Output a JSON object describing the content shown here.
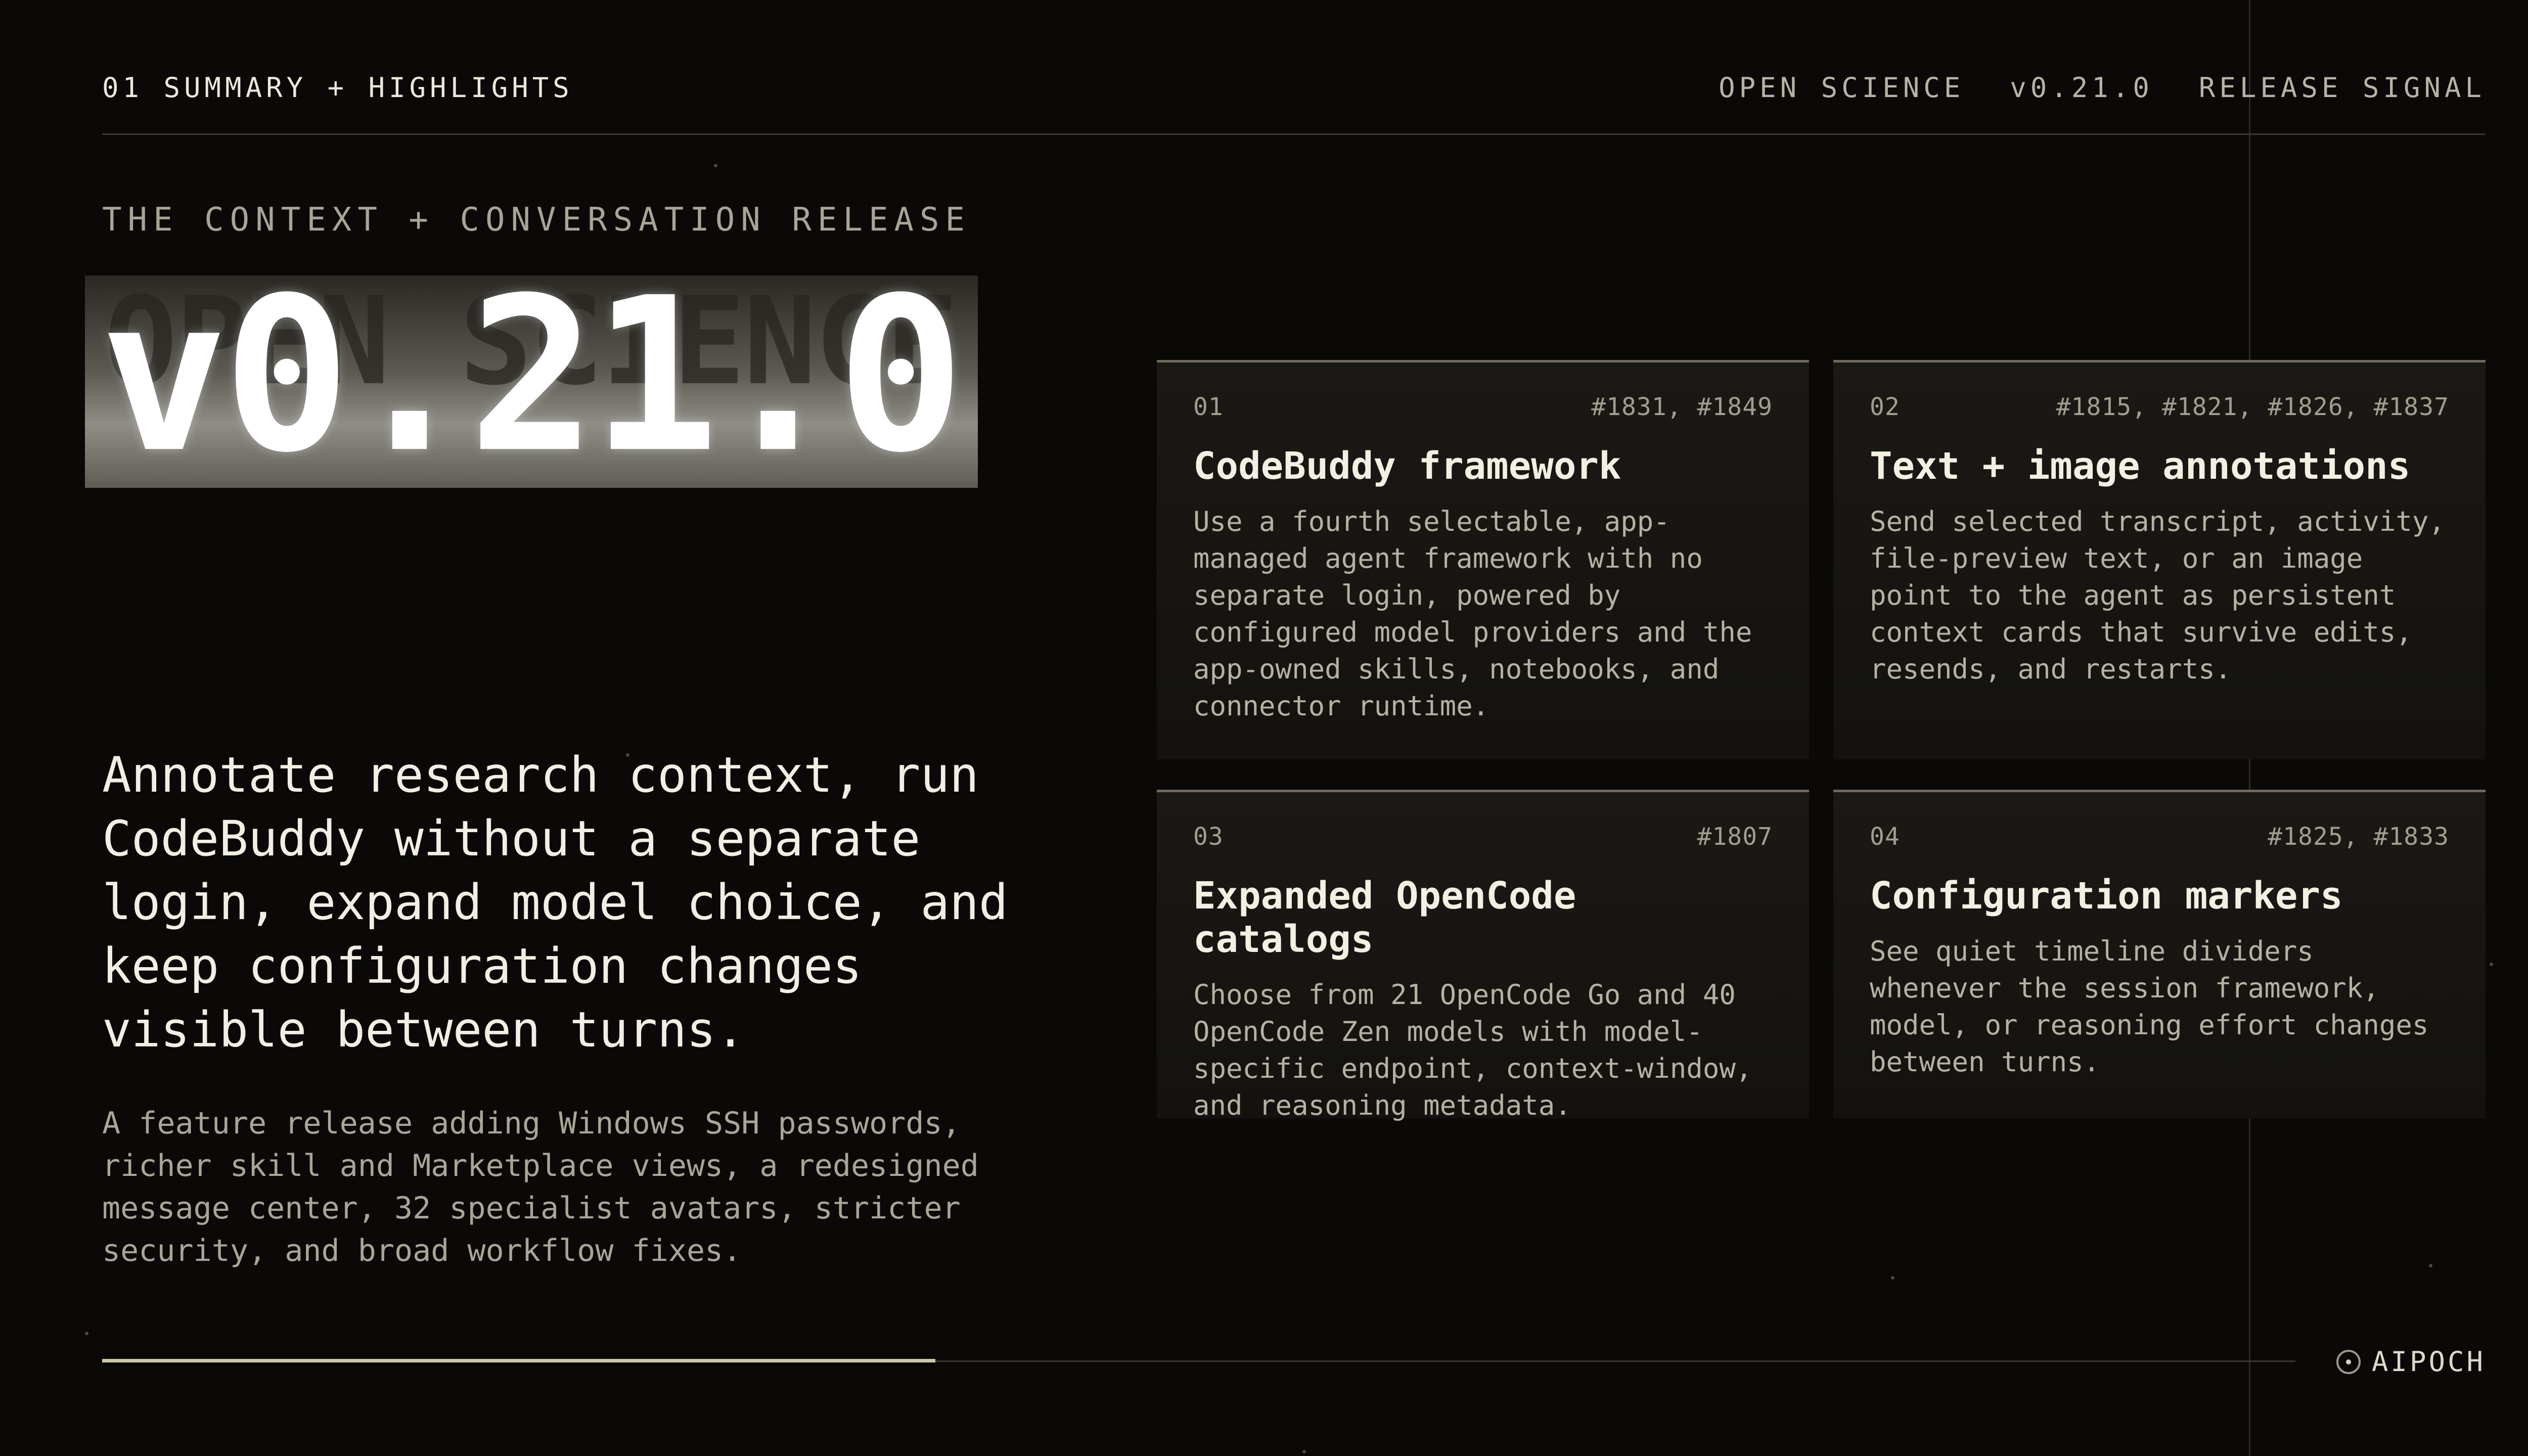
{
  "header": {
    "section": "01 SUMMARY + HIGHLIGHTS",
    "right_items": [
      "OPEN SCIENCE",
      "v0.21.0",
      "RELEASE SIGNAL"
    ]
  },
  "hero": {
    "eyebrow": "THE CONTEXT + CONVERSATION RELEASE",
    "ghost": "OPEN SCIENCE",
    "version": "v0.21.0"
  },
  "lede": "Annotate research context, run CodeBuddy without a separate login, expand model choice, and keep configuration changes visible between turns.",
  "note": "A feature release adding Windows SSH passwords, richer skill and Marketplace views, a redesigned message center, 32 specialist avatars, stricter security, and broad workflow fixes.",
  "cards": [
    {
      "number": "01",
      "refs": "#1831, #1849",
      "title": "CodeBuddy framework",
      "body": "Use a fourth selectable, app-managed agent framework with no separate login, powered by configured model providers and the app-owned skills, notebooks, and connector runtime."
    },
    {
      "number": "02",
      "refs": "#1815, #1821, #1826, #1837",
      "title": "Text + image annotations",
      "body": "Send selected transcript, activity, file-preview text, or an image point to the agent as persistent context cards that survive edits, resends, and restarts."
    },
    {
      "number": "03",
      "refs": "#1807",
      "title": "Expanded OpenCode catalogs",
      "body": "Choose from 21 OpenCode Go and 40 OpenCode Zen models with model-specific endpoint, context-window, and reasoning metadata."
    },
    {
      "number": "04",
      "refs": "#1825, #1833",
      "title": "Configuration markers",
      "body": "See quiet timeline dividers whenever the session framework, model, or reasoning effort changes between turns."
    }
  ],
  "footer": {
    "progress": 0.38,
    "brand": "AIPOCH"
  }
}
